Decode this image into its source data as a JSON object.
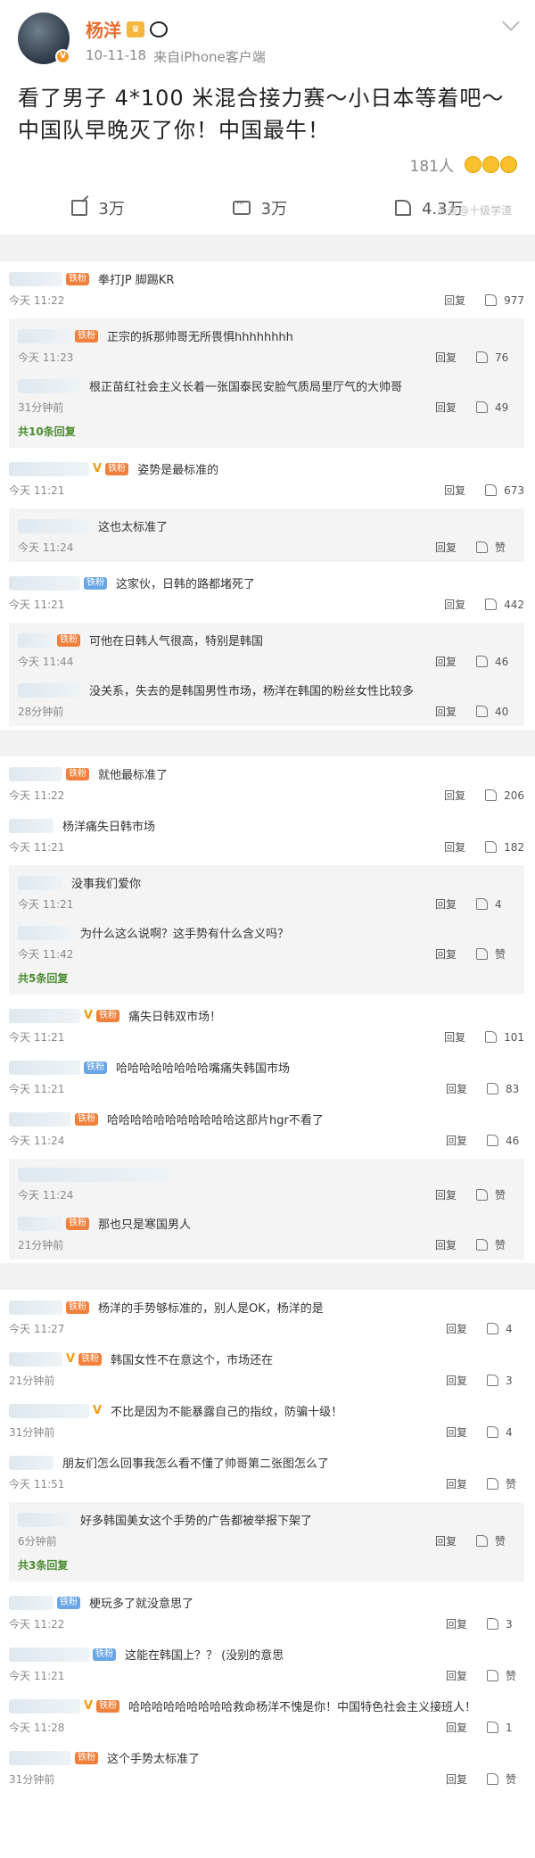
{
  "post": {
    "author": "杨洋",
    "date": "10-11-18",
    "source": "来自iPhone客户端",
    "text": "看了男子 4*100 米混合接力赛～小日本等着吧～中国队早晚灭了你！中国最牛！",
    "reactions": "181人",
    "actions": {
      "share": "3万",
      "comment": "3万",
      "like": "4.3万"
    },
    "watermark": "头条@十级学渣"
  },
  "labels": {
    "reply": "回复",
    "praise": "赞",
    "fan_badge": "铁粉",
    "v": "V"
  },
  "groups": [
    {
      "comments": [
        {
          "text": "拳打JP 脚踢KR",
          "time": "今天 11:22",
          "likes": "977",
          "badge": "铁粉",
          "nw": 60
        },
        {
          "sub": true,
          "text": "正宗的拆那帅哥无所畏惧hhhhhhhh",
          "time": "今天 11:23",
          "likes": "76",
          "badge": "铁粉",
          "nw": 60
        },
        {
          "sub": true,
          "text": "根正苗红社会主义长着一张国泰民安脸气质局里厅气的大帅哥",
          "time": "31分钟前",
          "likes": "49",
          "nw": 70
        },
        {
          "more": "共10条回复"
        },
        {
          "text": "姿势是最标准的",
          "time": "今天 11:21",
          "likes": "673",
          "badge": "铁粉",
          "vip": true,
          "nw": 90
        },
        {
          "sub": true,
          "text": "这也太标准了",
          "time": "今天 11:24",
          "likes": "赞",
          "nw": 80
        },
        {
          "text": "这家伙，日韩的路都堵死了",
          "time": "今天 11:21",
          "likes": "442",
          "badge": "铁粉",
          "blue": true,
          "nw": 80
        },
        {
          "sub": true,
          "text": "可他在日韩人气很高，特别是韩国",
          "time": "今天 11:44",
          "likes": "46",
          "badge": "铁粉",
          "nw": 40
        },
        {
          "sub": true,
          "text": "没关系，失去的是韩国男性市场，杨洋在韩国的粉丝女性比较多",
          "time": "28分钟前",
          "likes": "40",
          "nw": 70
        }
      ]
    },
    {
      "comments": [
        {
          "text": "就他最标准了",
          "time": "今天 11:22",
          "likes": "206",
          "badge": "铁粉",
          "nw": 60
        },
        {
          "text": "杨洋痛失日韩市场",
          "time": "今天 11:21",
          "likes": "182",
          "nw": 50
        },
        {
          "sub": true,
          "text": "没事我们爱你",
          "time": "今天 11:21",
          "likes": "4",
          "nw": 50
        },
        {
          "sub": true,
          "text": "为什么这么说啊？这手势有什么含义吗？",
          "time": "今天 11:42",
          "likes": "赞",
          "nw": 60
        },
        {
          "more": "共5条回复"
        },
        {
          "text": "痛失日韩双市场！",
          "time": "今天 11:21",
          "likes": "101",
          "badge": "铁粉",
          "vip": true,
          "nw": 80
        },
        {
          "text": "哈哈哈哈哈哈哈哈嘴痛失韩国市场",
          "time": "今天 11:21",
          "likes": "83",
          "badge": "铁粉",
          "blue": true,
          "nw": 80
        },
        {
          "text": "哈哈哈哈哈哈哈哈哈哈哈这部片hgr不看了",
          "time": "今天 11:24",
          "likes": "46",
          "badge": "铁粉",
          "nw": 70
        },
        {
          "sub": true,
          "text": "",
          "time": "今天 11:24",
          "likes": "赞",
          "nw": 170
        },
        {
          "sub": true,
          "text": "那也只是寒国男人",
          "time": "21分钟前",
          "likes": "赞",
          "badge": "铁粉",
          "nw": 50
        }
      ]
    },
    {
      "comments": [
        {
          "text": "杨洋的手势够标准的，别人是OK，杨洋的是",
          "time": "今天 11:27",
          "likes": "4",
          "badge": "铁粉",
          "nw": 60
        },
        {
          "text": "韩国女性不在意这个，市场还在",
          "time": "21分钟前",
          "likes": "3",
          "badge": "铁粉",
          "vip": true,
          "nw": 60
        },
        {
          "text": "不比是因为不能暴露自己的指纹，防骗十级！",
          "time": "31分钟前",
          "likes": "4",
          "vip": true,
          "nw": 90
        },
        {
          "text": "朋友们怎么回事我怎么看不懂了帅哥第二张图怎么了",
          "time": "今天 11:51",
          "likes": "赞",
          "nw": 50
        },
        {
          "sub": true,
          "text": "好多韩国美女这个手势的广告都被举报下架了",
          "time": "6分钟前",
          "likes": "赞",
          "nw": 60
        },
        {
          "more": "共3条回复"
        },
        {
          "text": "梗玩多了就没意思了",
          "time": "今天 11:22",
          "likes": "3",
          "badge": "铁粉",
          "blue": true,
          "nw": 50
        },
        {
          "text": "这能在韩国上？？  (没别的意思",
          "time": "今天 11:21",
          "likes": "赞",
          "badge": "铁粉",
          "blue": true,
          "nw": 90
        },
        {
          "text": "哈哈哈哈哈哈哈哈哈救命杨洋不愧是你！中国特色社会主义接班人！",
          "time": "今天 11:28",
          "likes": "1",
          "badge": "铁粉",
          "vip": true,
          "nw": 80
        },
        {
          "text": "这个手势太标准了",
          "time": "31分钟前",
          "likes": "赞",
          "badge": "铁粉",
          "nw": 70
        }
      ]
    }
  ]
}
